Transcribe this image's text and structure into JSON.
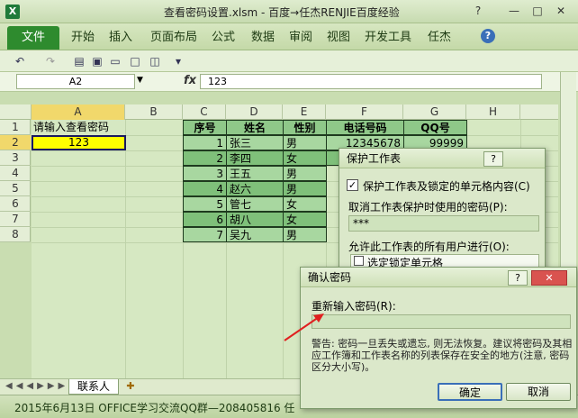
{
  "window": {
    "app_icon": "X",
    "title": "查看密码设置.xlsm - 百度→任杰RENJIE百度经验",
    "help_q": "?",
    "min": "—",
    "max": "□",
    "close": "✕"
  },
  "ribbon": {
    "tabs": [
      "文件",
      "开始",
      "插入",
      "页面布局",
      "公式",
      "数据",
      "审阅",
      "视图",
      "开发工具",
      "任杰"
    ],
    "help": "?"
  },
  "formula": {
    "cell_ref": "A2",
    "fx": "fx",
    "value": "123"
  },
  "grid": {
    "columns": [
      "A",
      "B",
      "C",
      "D",
      "E",
      "F",
      "G",
      "H"
    ],
    "rows": [
      "1",
      "2",
      "3",
      "4",
      "5",
      "6",
      "7",
      "8"
    ],
    "a1": "请输入查看密码",
    "a2": "123",
    "table_headers": [
      "序号",
      "姓名",
      "性别",
      "电话号码",
      "QQ号"
    ],
    "table_rows": [
      {
        "no": "1",
        "name": "张三",
        "sex": "男",
        "phone": "12345678",
        "qq": "99999"
      },
      {
        "no": "2",
        "name": "李四",
        "sex": "女",
        "phone": "",
        "qq": ""
      },
      {
        "no": "3",
        "name": "王五",
        "sex": "男",
        "phone": "",
        "qq": ""
      },
      {
        "no": "4",
        "name": "赵六",
        "sex": "男",
        "phone": "",
        "qq": ""
      },
      {
        "no": "5",
        "name": "管七",
        "sex": "女",
        "phone": "",
        "qq": ""
      },
      {
        "no": "6",
        "name": "胡八",
        "sex": "女",
        "phone": "",
        "qq": ""
      },
      {
        "no": "7",
        "name": "吴九",
        "sex": "男",
        "phone": "",
        "qq": ""
      }
    ]
  },
  "sheets": {
    "active": "联系人"
  },
  "status": {
    "text": "2015年6月13日   OFFICE学习交流QQ群—208405816   任"
  },
  "protect_dialog": {
    "title": "保护工作表",
    "help": "?",
    "checkbox_label": "保护工作表及锁定的单元格内容(C)",
    "password_label": "取消工作表保护时使用的密码(P):",
    "password_value": "***",
    "allow_label": "允许此工作表的所有用户进行(O):",
    "option_1": "选定锁定单元格"
  },
  "confirm_dialog": {
    "title": "确认密码",
    "help": "?",
    "close": "✕",
    "reenter_label": "重新输入密码(R):",
    "input_value": "",
    "warning": "警告: 密码一旦丢失或遗忘, 则无法恢复。建议将密码及其相应工作簿和工作表名称的列表保存在安全的地方(注意, 密码区分大小写)。",
    "ok": "确定",
    "cancel": "取消"
  },
  "colors": {
    "table_header": "#8fc889",
    "highlight_yellow": "#ffff00",
    "arrow": "#e02020"
  }
}
